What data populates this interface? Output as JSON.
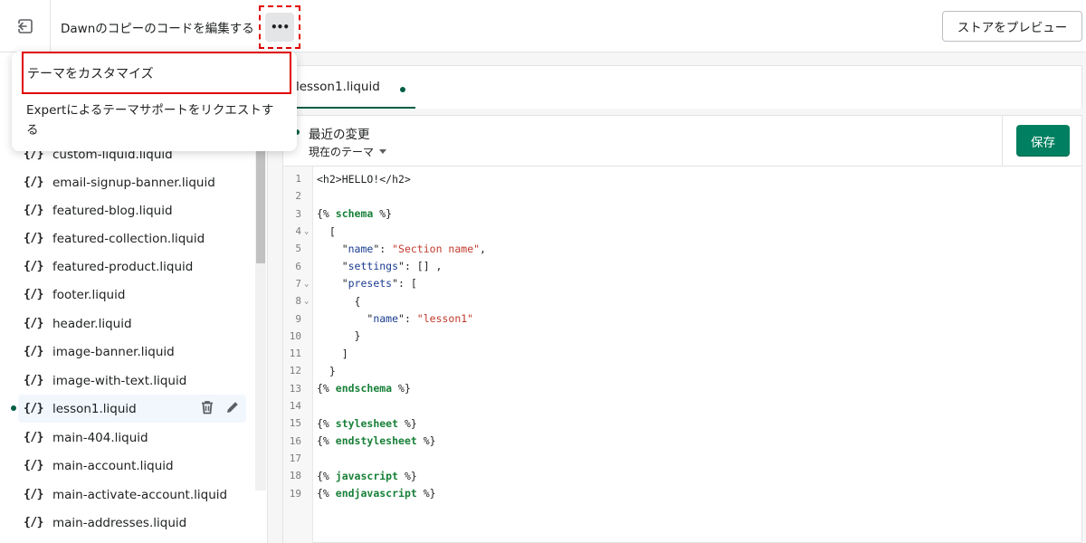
{
  "header": {
    "title": "Dawnのコピーのコードを編集する",
    "more_label": "•••",
    "preview_label": "ストアをプレビュー"
  },
  "menu": {
    "items": [
      {
        "label": "テーマをカスタマイズ"
      },
      {
        "label": "Expertによるテーマサポートをリクエストする"
      }
    ]
  },
  "sidebar": {
    "icon_text": "{/}",
    "files": [
      {
        "name": "custom-liquid.liquid"
      },
      {
        "name": "email-signup-banner.liquid"
      },
      {
        "name": "featured-blog.liquid"
      },
      {
        "name": "featured-collection.liquid"
      },
      {
        "name": "featured-product.liquid"
      },
      {
        "name": "footer.liquid"
      },
      {
        "name": "header.liquid"
      },
      {
        "name": "image-banner.liquid"
      },
      {
        "name": "image-with-text.liquid"
      },
      {
        "name": "lesson1.liquid"
      },
      {
        "name": "main-404.liquid"
      },
      {
        "name": "main-account.liquid"
      },
      {
        "name": "main-activate-account.liquid"
      },
      {
        "name": "main-addresses.liquid"
      }
    ],
    "active_index": 9
  },
  "editor": {
    "tab_label": "lesson1.liquid",
    "changes_title": "最近の変更",
    "version_label": "現在のテーマ",
    "save_label": "保存",
    "lines": [
      {
        "n": "1",
        "html": "<h2>HELLO!</h2>"
      },
      {
        "n": "2",
        "html": ""
      },
      {
        "n": "3",
        "html": "{% schema %}"
      },
      {
        "n": "4",
        "html": "  ["
      },
      {
        "n": "5",
        "html": "    \"name\": \"Section name\","
      },
      {
        "n": "6",
        "html": "    \"settings\": [] ,"
      },
      {
        "n": "7",
        "html": "    \"presets\": ["
      },
      {
        "n": "8",
        "html": "      {"
      },
      {
        "n": "9",
        "html": "        \"name\": \"lesson1\""
      },
      {
        "n": "10",
        "html": "      }"
      },
      {
        "n": "11",
        "html": "    ]"
      },
      {
        "n": "12",
        "html": "  }"
      },
      {
        "n": "13",
        "html": "{% endschema %}"
      },
      {
        "n": "14",
        "html": ""
      },
      {
        "n": "15",
        "html": "{% stylesheet %}"
      },
      {
        "n": "16",
        "html": "{% endstylesheet %}"
      },
      {
        "n": "17",
        "html": ""
      },
      {
        "n": "18",
        "html": "{% javascript %}"
      },
      {
        "n": "19",
        "html": "{% endjavascript %}"
      }
    ],
    "fold_lines": [
      "4",
      "7",
      "8"
    ]
  },
  "colors": {
    "accent": "#008060",
    "active_dot": "#005e46",
    "highlight_red": "#e10000"
  }
}
